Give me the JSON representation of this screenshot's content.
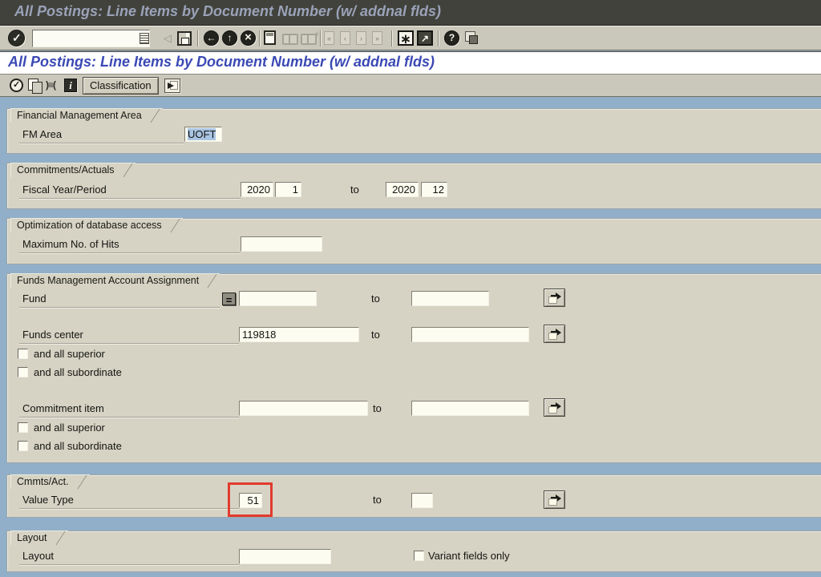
{
  "window_title": "All Postings: Line Items by Document Number (w/ addnal flds)",
  "page_title": "All Postings: Line Items by Document Number (w/ addnal flds)",
  "toolbar": {
    "command_value": ""
  },
  "app_toolbar": {
    "classification": "Classification"
  },
  "labels": {
    "to": "to",
    "superior": "and all superior",
    "subordinate": "and all subordinate"
  },
  "sections": {
    "fma": {
      "title": "Financial Management Area",
      "fm_area_label": "FM Area",
      "fm_area_value": "UOFT"
    },
    "ca": {
      "title": "Commitments/Actuals",
      "fiscal_label": "Fiscal Year/Period",
      "year_from": "2020",
      "period_from": "1",
      "year_to": "2020",
      "period_to": "12"
    },
    "opt": {
      "title": "Optimization of database access",
      "max_hits_label": "Maximum No. of Hits",
      "max_hits_value": ""
    },
    "fmaa": {
      "title": "Funds Management Account Assignment",
      "fund_label": "Fund",
      "fund_from": "",
      "fund_to": "",
      "funds_center_label": "Funds center",
      "funds_center_from": "119818",
      "funds_center_to": "",
      "commitment_item_label": "Commitment item",
      "commitment_from": "",
      "commitment_to": ""
    },
    "cmmts": {
      "title": "Cmmts/Act.",
      "value_type_label": "Value Type",
      "value_type_from": "51",
      "value_type_to": ""
    },
    "layout": {
      "title": "Layout",
      "layout_label": "Layout",
      "layout_value": "",
      "variant_label": "Variant fields only"
    }
  },
  "colors": {
    "page_title_blue": "#3b49b4",
    "annotation_red": "#e23b2e",
    "selection_bg": "#a9c4e2",
    "section_bg": "#d6d3c4",
    "content_bg": "#91afc8"
  }
}
